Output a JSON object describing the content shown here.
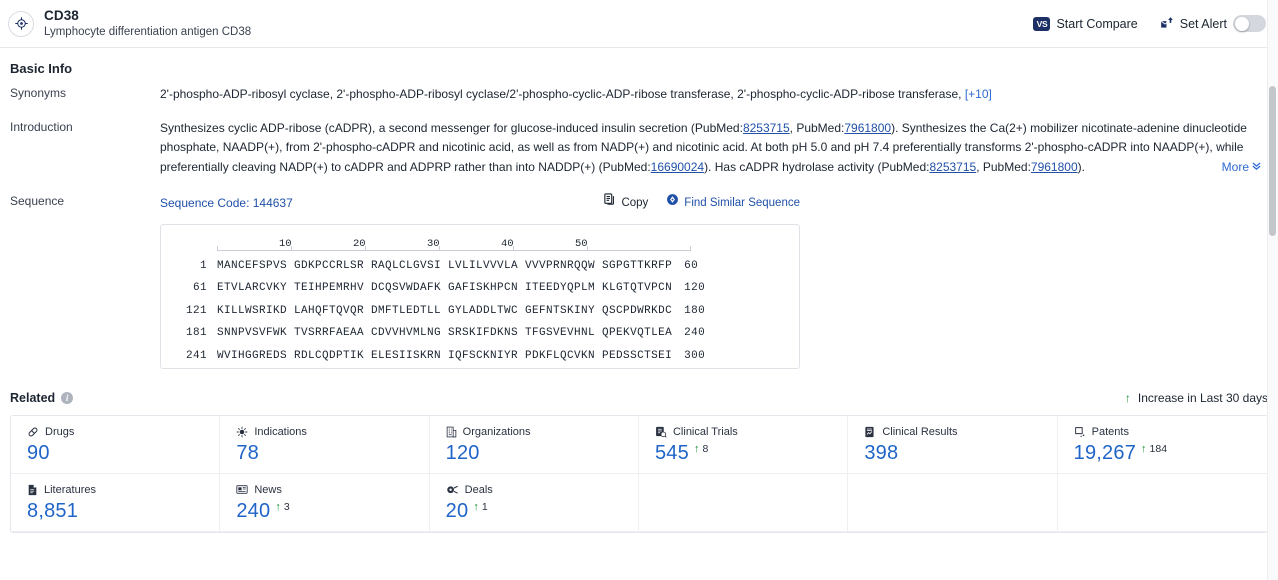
{
  "header": {
    "target_icon": "target-crosshair-icon",
    "title": "CD38",
    "subtitle": "Lymphocyte differentiation antigen CD38",
    "start_compare_label": "Start Compare",
    "start_compare_badge": "VS",
    "set_alert_label": "Set Alert",
    "alert_toggle_state": "off"
  },
  "basic_info": {
    "section_title": "Basic Info",
    "synonyms_label": "Synonyms",
    "synonyms_text": "2'-phospho-ADP-ribosyl cyclase,  2'-phospho-ADP-ribosyl cyclase/2'-phospho-cyclic-ADP-ribose transferase,  2'-phospho-cyclic-ADP-ribose transferase,",
    "synonyms_more": "[+10]",
    "introduction_label": "Introduction",
    "introduction": {
      "p1": "Synthesizes cyclic ADP-ribose (cADPR), a second messenger for glucose-induced insulin secretion (PubMed:",
      "pm1": "8253715",
      "p2": ", PubMed:",
      "pm2": "7961800",
      "p3": "). Synthesizes the Ca(2+) mobilizer nicotinate-adenine dinucleotide phosphate, NAADP(+), from 2'-phospho-cADPR and nicotinic acid, as well as from NADP(+) and nicotinic acid. At both pH 5.0 and pH 7.4 preferentially transforms 2'-phospho-cADPR into NAADP(+), while preferentially cleaving NADP(+) to cADPR and ADPRP rather than into NADDP(+) (PubMed:",
      "pm3": "16690024",
      "p4": "). Has cADPR hydrolase activity (PubMed:",
      "pm4": "8253715",
      "p5": ", PubMed:",
      "pm5": "7961800",
      "p6": ")."
    },
    "more_label": "More"
  },
  "sequence": {
    "label": "Sequence",
    "code_label": "Sequence Code: 144637",
    "copy_label": "Copy",
    "find_similar_label": "Find Similar Sequence",
    "ruler_ticks": [
      "10",
      "20",
      "30",
      "40",
      "50"
    ],
    "rows": [
      {
        "start": "1",
        "chunks": [
          "MANCEFSPVS",
          "GDKPCCRLSR",
          "RAQLCLGVSI",
          "LVLILVVVLA",
          "VVVPRNRQQW",
          "SGPGTTKRFP"
        ],
        "end": "60"
      },
      {
        "start": "61",
        "chunks": [
          "ETVLARCVKY",
          "TEIHPEMRHV",
          "DCQSVWDAFK",
          "GAFISKHPCN",
          "ITEEDYQPLM",
          "KLGTQTVPCN"
        ],
        "end": "120"
      },
      {
        "start": "121",
        "chunks": [
          "KILLWSRIKD",
          "LAHQFTQVQR",
          "DMFTLEDTLL",
          "GYLADDLTWC",
          "GEFNTSKINY",
          "QSCPDWRKDC"
        ],
        "end": "180"
      },
      {
        "start": "181",
        "chunks": [
          "SNNPVSVFWK",
          "TVSRRFAEAA",
          "CDVVHVMLNG",
          "SRSKIFDKNS",
          "TFGSVEVHNL",
          "QPEKVQTLEA"
        ],
        "end": "240"
      },
      {
        "start": "241",
        "chunks": [
          "WVIHGGREDS",
          "RDLCQDPTIK",
          "ELESIISKRN",
          "IQFSCKNIYR",
          "PDKFLQCVKN",
          "PEDSSCTSEI"
        ],
        "end": "300"
      }
    ]
  },
  "related": {
    "title": "Related",
    "info_icon": "info-icon",
    "increase_note": "Increase in Last 30 days",
    "increase_arrow": "↑",
    "cards": [
      {
        "icon": "capsule-icon",
        "label": "Drugs",
        "value": "90",
        "delta": ""
      },
      {
        "icon": "virus-icon",
        "label": "Indications",
        "value": "78",
        "delta": ""
      },
      {
        "icon": "building-icon",
        "label": "Organizations",
        "value": "120",
        "delta": ""
      },
      {
        "icon": "clinical-trial-icon",
        "label": "Clinical Trials",
        "value": "545",
        "delta": "8"
      },
      {
        "icon": "clinical-result-icon",
        "label": "Clinical Results",
        "value": "398",
        "delta": ""
      },
      {
        "icon": "patent-icon",
        "label": "Patents",
        "value": "19,267",
        "delta": "184"
      },
      {
        "icon": "literature-icon",
        "label": "Literatures",
        "value": "8,851",
        "delta": ""
      },
      {
        "icon": "news-icon",
        "label": "News",
        "value": "240",
        "delta": "3"
      },
      {
        "icon": "deals-icon",
        "label": "Deals",
        "value": "20",
        "delta": "1"
      }
    ]
  },
  "colors": {
    "accent_blue": "#1f64c8",
    "link_blue": "#2050a8",
    "navy": "#1c3066",
    "green": "#1a9338",
    "border": "#e4e7eb"
  }
}
